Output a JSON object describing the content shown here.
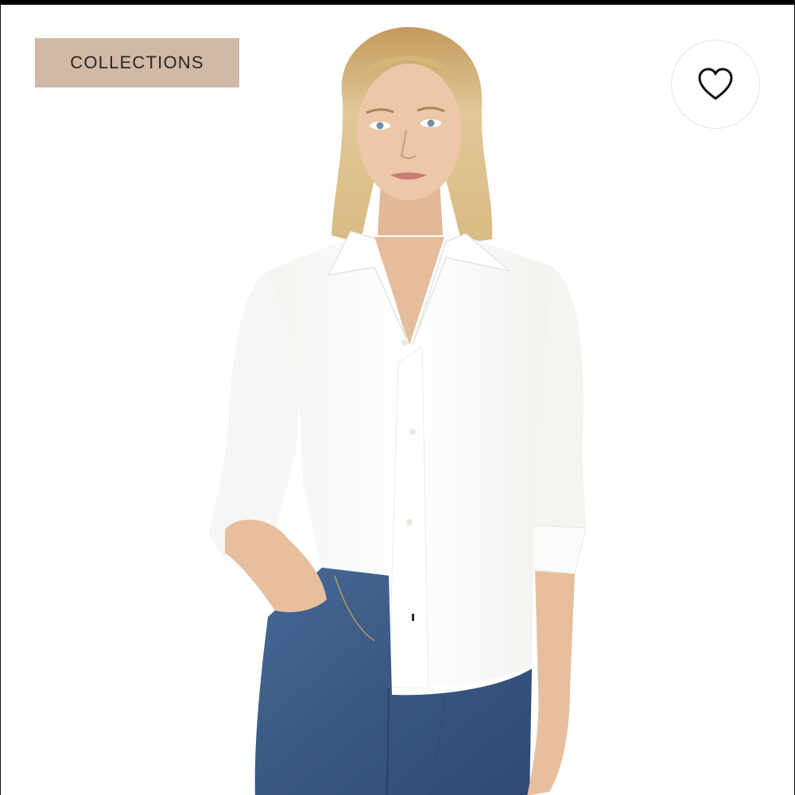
{
  "tag": {
    "label": "COLLECTIONS",
    "background_color": "#d1b9a6",
    "text_color": "#2b2623"
  },
  "favorite": {
    "icon": "heart-outline-icon",
    "icon_color": "#111111"
  },
  "photo": {
    "subject": "product-photo",
    "shirt_color": "#fbfbf9",
    "jeans_color": "#3c5a86",
    "hair_color": "#d8bd86",
    "skin_color": "#e8c2a4",
    "background_color": "#ffffff"
  }
}
